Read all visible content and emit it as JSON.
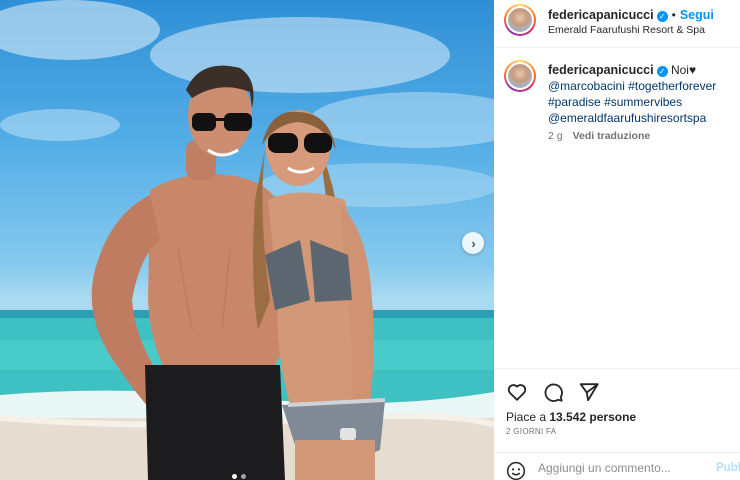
{
  "post": {
    "username": "federicapanicucci",
    "verified_symbol": "✓",
    "separator": "•",
    "follow_label": "Segui",
    "location": "Emerald Faarufushi Resort & Spa"
  },
  "caption": {
    "username": "federicapanicucci",
    "text": "Noi♥",
    "tags": [
      "@marcobacini",
      "#togetherforever",
      "#paradise",
      "#summervibes",
      "@emeraldfaarufushiresortspa"
    ],
    "age": "2 g",
    "translate_label": "Vedi traduzione"
  },
  "media": {
    "next_symbol": "›",
    "slide_count": 2,
    "active_slide": 1
  },
  "engagement": {
    "likes_prefix": "Piace a",
    "likes_count": "13.542",
    "likes_suffix": "persone",
    "time_ago": "2 GIORNI FA"
  },
  "comment": {
    "placeholder": "Aggiungi un commento...",
    "publish_label": "Pubblica"
  },
  "icons": {
    "like": "heart-icon",
    "comment": "comment-icon",
    "share": "share-icon",
    "emoji": "emoji-icon",
    "next": "chevron-right-icon"
  },
  "colors": {
    "link_blue": "#0095f6",
    "hashtag": "#00376b",
    "muted": "#737373"
  }
}
